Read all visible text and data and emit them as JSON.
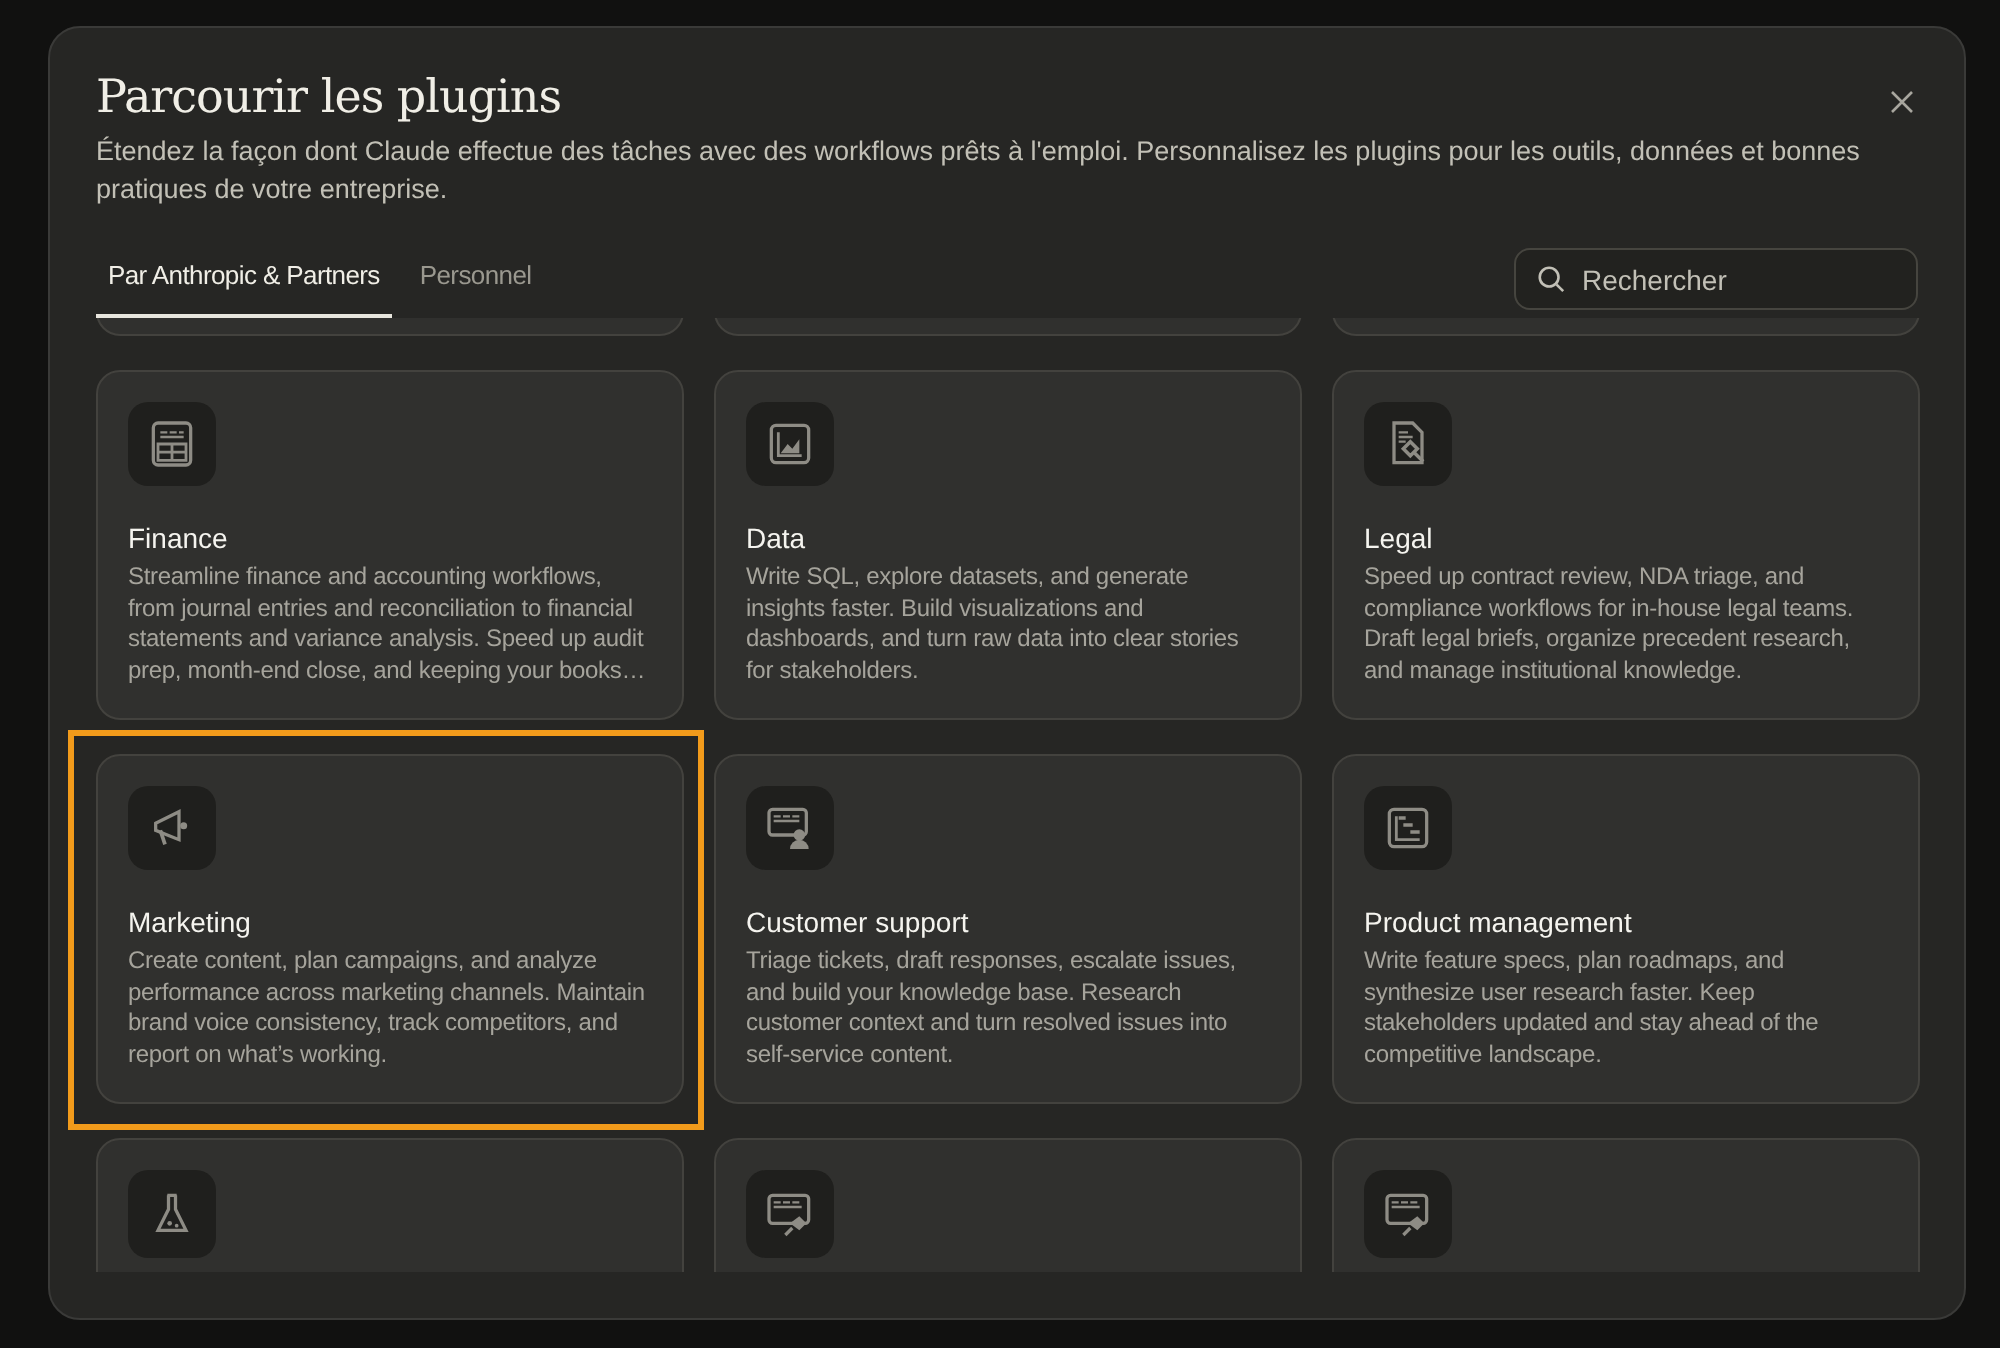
{
  "dialog": {
    "title": "Parcourir les plugins",
    "subtitle": "Étendez la façon dont Claude effectue des tâches avec des workflows prêts à l'emploi. Personnalisez les plugins pour les outils, données et bonnes pratiques de votre entreprise."
  },
  "tabs": [
    {
      "label": "Par Anthropic & Partners",
      "selected": true
    },
    {
      "label": "Personnel",
      "selected": false
    }
  ],
  "search": {
    "placeholder": "Rechercher"
  },
  "cards": [
    {
      "kind": "cut",
      "highlighted": false
    },
    {
      "kind": "cut",
      "highlighted": false
    },
    {
      "kind": "cut",
      "highlighted": false
    },
    {
      "kind": "full",
      "highlighted": false,
      "title": "Finance",
      "description": "Streamline finance and accounting workflows, from journal entries and reconciliation to financial statements and variance analysis. Speed up audit prep, month-end close, and keeping your books…"
    },
    {
      "kind": "full",
      "highlighted": false,
      "title": "Data",
      "description": "Write SQL, explore datasets, and generate insights faster. Build visualizations and dashboards, and turn raw data into clear stories for stakeholders."
    },
    {
      "kind": "full",
      "highlighted": false,
      "title": "Legal",
      "description": "Speed up contract review, NDA triage, and compliance workflows for in-house legal teams. Draft legal briefs, organize precedent research, and manage institutional knowledge."
    },
    {
      "kind": "full",
      "highlighted": true,
      "title": "Marketing",
      "description": "Create content, plan campaigns, and analyze performance across marketing channels. Maintain brand voice consistency, track competitors, and report on what’s working."
    },
    {
      "kind": "full",
      "highlighted": false,
      "title": "Customer support",
      "description": "Triage tickets, draft responses, escalate issues, and build your knowledge base. Research customer context and turn resolved issues into self-service content."
    },
    {
      "kind": "full",
      "highlighted": false,
      "title": "Product management",
      "description": "Write feature specs, plan roadmaps, and synthesize user research faster. Keep stakeholders updated and stay ahead of the competitive landscape."
    },
    {
      "kind": "icon-only",
      "highlighted": false
    },
    {
      "kind": "icon-only",
      "highlighted": false
    },
    {
      "kind": "icon-only",
      "highlighted": false
    }
  ]
}
